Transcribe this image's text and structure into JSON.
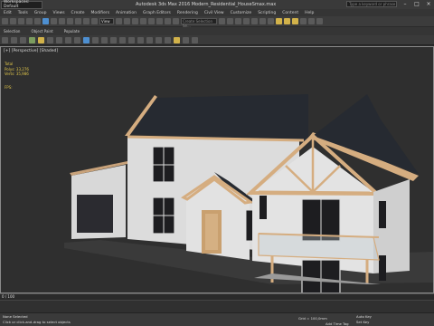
{
  "titlebar": {
    "workspace": "Workspaces: Default",
    "title": "Autodesk 3ds Max 2016   Modern_Residential_HouseSmax.max",
    "search_placeholder": "Type a keyword or phrase"
  },
  "menubar": {
    "items": [
      "Edit",
      "Tools",
      "Group",
      "Views",
      "Create",
      "Modifiers",
      "Animation",
      "Graph Editors",
      "Rendering",
      "Civil View",
      "Customize",
      "Scripting",
      "Content",
      "Help"
    ]
  },
  "toolbar": {
    "view_dropdown": "View",
    "named_selection": "Create Selection Se..."
  },
  "ribbon": {
    "tabs": [
      "Selection",
      "Object Paint",
      "Populate"
    ]
  },
  "viewport": {
    "label": "[+] [Perspective] [Shaded]",
    "stats": {
      "total_label": "Total",
      "polys_label": "Polys:",
      "polys_value": "33,276",
      "verts_label": "Verts:",
      "verts_value": "35,986",
      "fps_label": "FPS:"
    }
  },
  "timeline": {
    "frame": "0 / 100"
  },
  "status": {
    "line1": "None Selected",
    "line2": "Click or click-and-drag to select objects",
    "grid": "Grid = 100,0mm",
    "add_time_tag": "Add Time Tag",
    "auto_key": "Auto Key",
    "set_key": "Set Key"
  },
  "colors": {
    "viewport_bg": "#2f2f2f",
    "siding": "#d9d9d9",
    "trim": "#d5ad80",
    "roof": "#262a31",
    "stats": "#e0c64a"
  }
}
